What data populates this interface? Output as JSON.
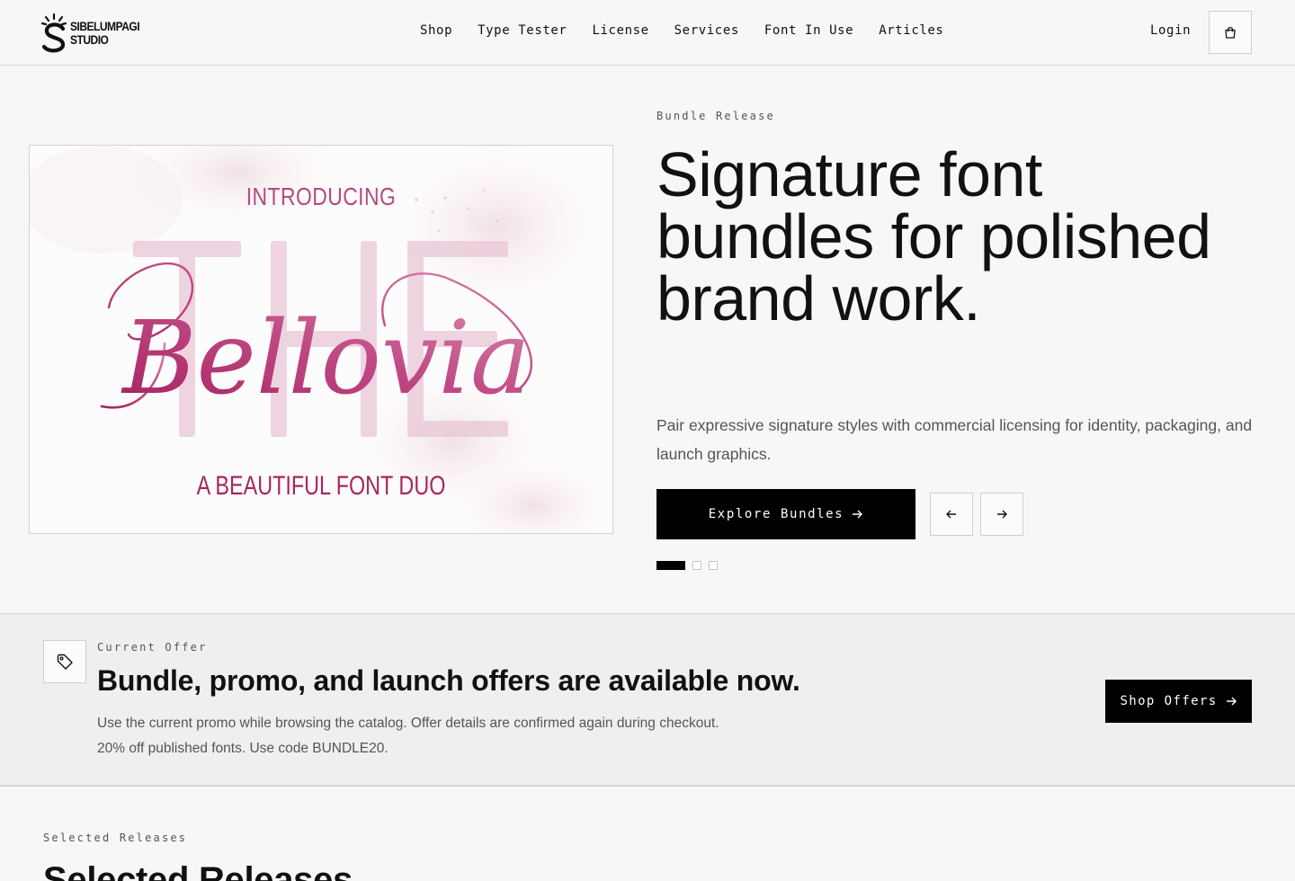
{
  "brand": {
    "line1": "SIBELUMPAGI",
    "line2": "STUDIO"
  },
  "nav": {
    "items": [
      "Shop",
      "Type Tester",
      "License",
      "Services",
      "Font In Use",
      "Articles"
    ],
    "login": "Login",
    "cart_icon": "shopping-bag-icon"
  },
  "hero": {
    "eyebrow": "Bundle Release",
    "title": "Signature font bundles for polished brand work.",
    "subtitle": "Pair expressive signature styles with commercial licensing for identity, packaging, and launch graphics.",
    "cta_label": "Explore Bundles",
    "prev_icon": "arrow-left-icon",
    "next_icon": "arrow-right-icon",
    "slide_count": 3,
    "active_slide": 1,
    "image": {
      "introducing": "INTRODUCING",
      "backdrop_word": "THE",
      "script_name": "Bellovia",
      "tagline": "A BEAUTIFUL FONT DUO",
      "accent_color": "#b02a6b",
      "backdrop_color": "#e9c7d7"
    }
  },
  "offer": {
    "eyebrow": "Current Offer",
    "title": "Bundle, promo, and launch offers are available now.",
    "line1": "Use the current promo while browsing the catalog. Offer details are confirmed again during checkout.",
    "line2": "20% off published fonts. Use code BUNDLE20.",
    "cta_label": "Shop Offers",
    "icon": "tag-icon"
  },
  "releases": {
    "eyebrow": "Selected Releases",
    "title": "Selected Releases"
  }
}
